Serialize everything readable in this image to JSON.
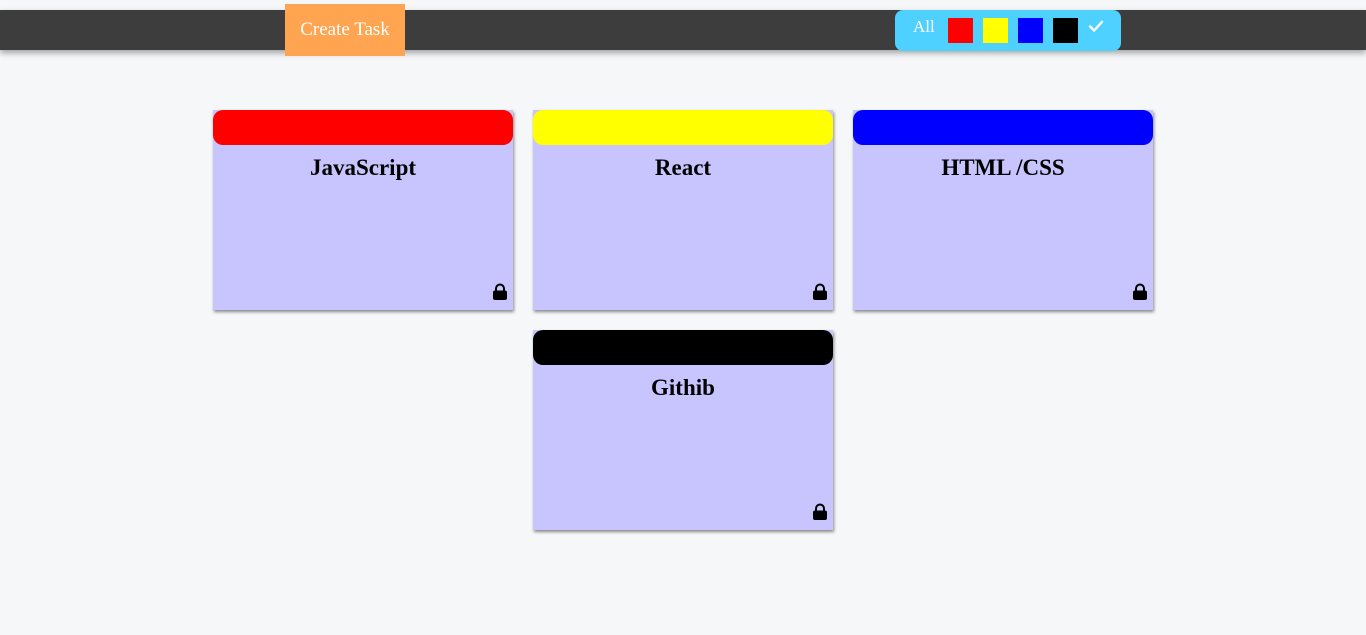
{
  "toolbar": {
    "create_label": "Create Task"
  },
  "filter": {
    "all_label": "All",
    "colors": [
      "#ff0000",
      "#ffff00",
      "#0000ff",
      "#000000"
    ],
    "confirm_icon": "check-icon"
  },
  "cards": [
    {
      "title": "JavaScript",
      "color": "#ff0000",
      "icon": "lock-icon"
    },
    {
      "title": "React",
      "color": "#ffff00",
      "icon": "lock-icon"
    },
    {
      "title": "HTML /CSS",
      "color": "#0000ff",
      "icon": "lock-icon"
    },
    {
      "title": "Githib",
      "color": "#000000",
      "icon": "lock-icon"
    }
  ],
  "theme": {
    "topbar": "#3d3d3d",
    "create_button": "#ffa551",
    "filter_bar": "#4fd1ff",
    "card_body": "#c8c5fe",
    "page_background": "#f6f7f9"
  }
}
